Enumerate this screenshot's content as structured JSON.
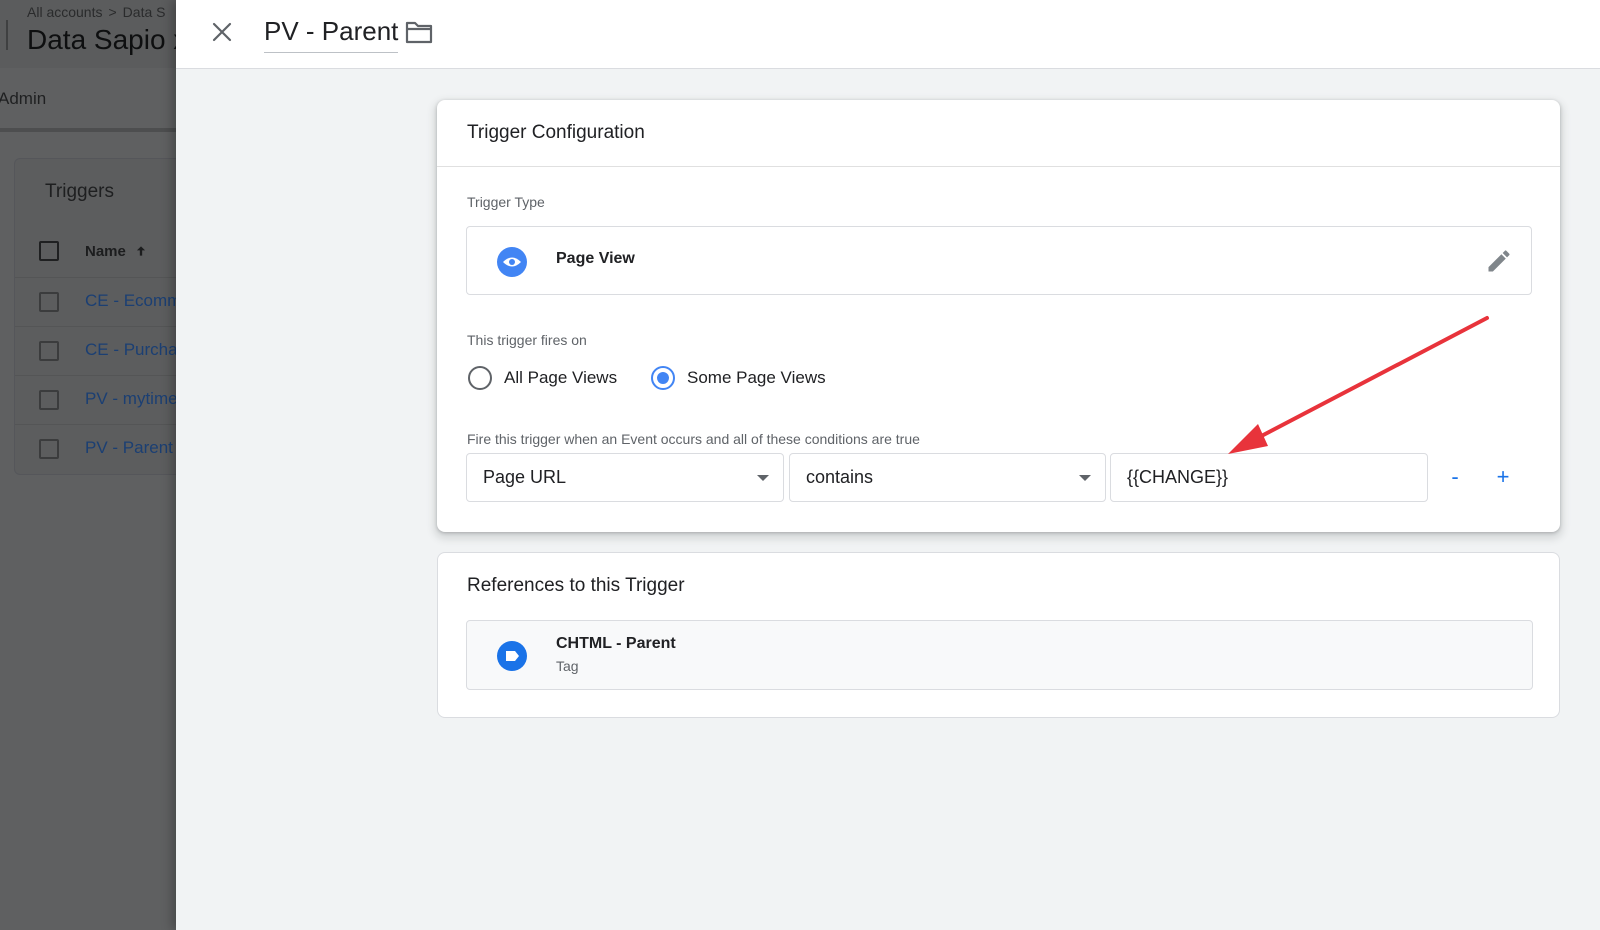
{
  "background": {
    "breadcrumb": [
      "All accounts",
      "Data S"
    ],
    "breadcrumb_sep": ">",
    "account_name": "Data Sapio x",
    "nav_item": "Admin",
    "triggers_title": "Triggers",
    "column_name": "Name",
    "sort_icon": "arrow-up-icon",
    "rows": [
      "CE - Ecomm",
      "CE - Purcha",
      "PV - mytime",
      "PV - Parent"
    ]
  },
  "panel": {
    "title": "PV - Parent",
    "close_icon": "close-icon",
    "folder_icon": "folder-icon"
  },
  "config": {
    "title": "Trigger Configuration",
    "trigger_type_label": "Trigger Type",
    "trigger_type_name": "Page View",
    "trigger_type_icon": "eye-icon",
    "edit_icon": "pencil-icon",
    "fires_on_label": "This trigger fires on",
    "fires_on_options": [
      {
        "label": "All Page Views",
        "selected": false
      },
      {
        "label": "Some Page Views",
        "selected": true
      }
    ],
    "condition_label": "Fire this trigger when an Event occurs and all of these conditions are true",
    "condition": {
      "variable": "Page URL",
      "operator": "contains",
      "value": "{{CHANGE}}"
    },
    "remove_label": "-",
    "add_label": "+"
  },
  "references": {
    "title": "References to this Trigger",
    "items": [
      {
        "name": "CHTML - Parent",
        "type": "Tag",
        "icon": "tag-icon"
      }
    ]
  },
  "annotation": {
    "arrow_color": "#e8333b"
  },
  "colors": {
    "accent": "#4285f4",
    "link": "#1a73e8"
  }
}
